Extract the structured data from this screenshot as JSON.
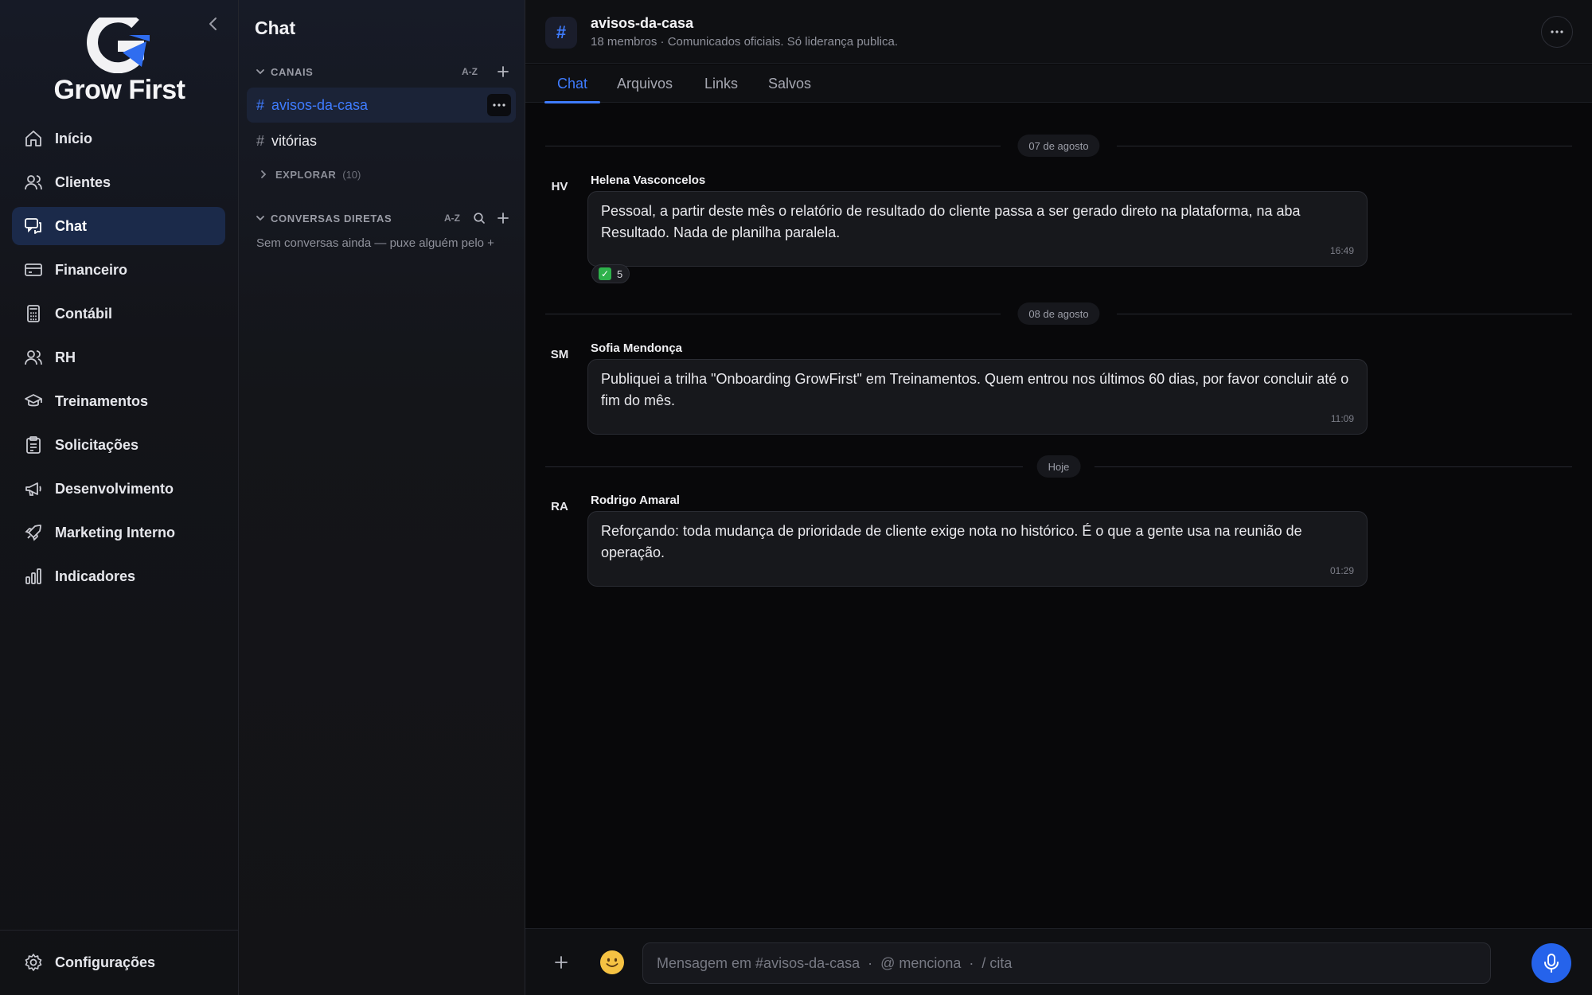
{
  "brand": {
    "name": "Grow First"
  },
  "nav": {
    "items": [
      {
        "label": "Início",
        "icon": "home-icon"
      },
      {
        "label": "Clientes",
        "icon": "users-icon"
      },
      {
        "label": "Chat",
        "icon": "chat-icon",
        "active": true
      },
      {
        "label": "Financeiro",
        "icon": "credit-card-icon"
      },
      {
        "label": "Contábil",
        "icon": "calculator-icon"
      },
      {
        "label": "RH",
        "icon": "users-icon"
      },
      {
        "label": "Treinamentos",
        "icon": "graduation-cap-icon"
      },
      {
        "label": "Solicitações",
        "icon": "clipboard-icon"
      },
      {
        "label": "Desenvolvimento",
        "icon": "megaphone-icon"
      },
      {
        "label": "Marketing Interno",
        "icon": "rocket-icon"
      },
      {
        "label": "Indicadores",
        "icon": "bar-chart-icon"
      }
    ],
    "settings_label": "Configurações"
  },
  "panel": {
    "title": "Chat",
    "channels_header": "CANAIS",
    "sort_label": "A-Z",
    "channels": [
      {
        "name": "avisos-da-casa",
        "active": true
      },
      {
        "name": "vitórias"
      }
    ],
    "explore_label": "EXPLORAR",
    "explore_count": "(10)",
    "dm_header": "CONVERSAS DIRETAS",
    "dm_sort_label": "A-Z",
    "dm_empty": "Sem conversas ainda — puxe alguém pelo +"
  },
  "channel": {
    "hash": "#",
    "name": "avisos-da-casa",
    "meta": "18 membros · Comunicados oficiais. Só liderança publica."
  },
  "tabs": [
    "Chat",
    "Arquivos",
    "Links",
    "Salvos"
  ],
  "messages": {
    "sep1": "07 de agosto",
    "m1": {
      "initials": "HV",
      "author": "Helena Vasconcelos",
      "text": "Pessoal, a partir deste mês o relatório de resultado do cliente passa a ser gerado direto na plataforma, na aba Resultado. Nada de planilha paralela.",
      "time": "16:49",
      "reaction_emoji": "✓",
      "reaction_count": "5"
    },
    "sep2": "08 de agosto",
    "m2": {
      "initials": "SM",
      "author": "Sofia Mendonça",
      "text": "Publiquei a trilha \"Onboarding GrowFirst\" em Treinamentos. Quem entrou nos últimos 60 dias, por favor concluir até o fim do mês.",
      "time": "11:09"
    },
    "sep3": "Hoje",
    "m3": {
      "initials": "RA",
      "author": "Rodrigo Amaral",
      "text": "Reforçando: toda mudança de prioridade de cliente exige nota no histórico. É o que a gente usa na reunião de operação.",
      "time": "01:29"
    }
  },
  "composer": {
    "placeholder": "Mensagem em #avisos-da-casa  ·  @ menciona  ·  / cita"
  },
  "colors": {
    "accent": "#3f7cff",
    "nav_active_bg": "#1b2a4a",
    "mic_button": "#2563eb",
    "reaction_check": "#2eb24b"
  }
}
